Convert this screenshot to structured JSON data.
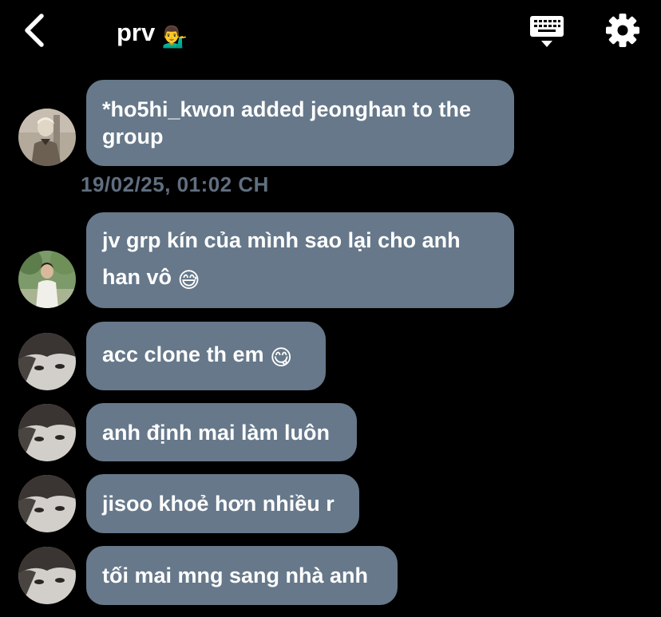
{
  "header": {
    "title": "prv",
    "title_emoji": "💁‍♂️",
    "back_icon": "chevron-left-icon",
    "keyboard_icon": "keyboard-icon",
    "settings_icon": "gear-icon"
  },
  "colors": {
    "background": "#000000",
    "bubble": "#66788a",
    "timestamp": "#5f6f80",
    "text": "#ffffff"
  },
  "messages": [
    {
      "text": "*ho5hi_kwon added jeonghan to the group",
      "emoji": ""
    },
    {
      "text": "jv grp kín của mình sao lại cho anh han vô",
      "emoji": "😅"
    },
    {
      "text": "acc clone th em",
      "emoji": "😋"
    },
    {
      "text": "anh định mai làm luôn",
      "emoji": ""
    },
    {
      "text": "jisoo khoẻ hơn nhiều r",
      "emoji": ""
    },
    {
      "text": "tối mai mng sang nhà anh",
      "emoji": ""
    }
  ],
  "timestamp": "19/02/25, 01:02 CH"
}
